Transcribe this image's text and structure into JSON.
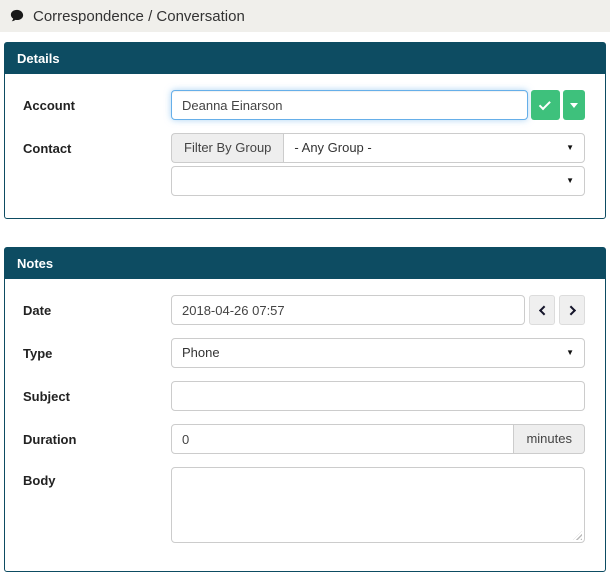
{
  "header": {
    "title": "Correspondence / Conversation"
  },
  "details": {
    "title": "Details",
    "account": {
      "label": "Account",
      "value": "Deanna Einarson"
    },
    "contact": {
      "label": "Contact",
      "filter_addon_label": "Filter By Group",
      "group_select_value": "- Any Group -",
      "contact_select_value": ""
    }
  },
  "notes": {
    "title": "Notes",
    "date": {
      "label": "Date",
      "value": "2018-04-26 07:57"
    },
    "type": {
      "label": "Type",
      "value": "Phone"
    },
    "subject": {
      "label": "Subject",
      "value": ""
    },
    "duration": {
      "label": "Duration",
      "value": "0",
      "unit_label": "minutes"
    },
    "body": {
      "label": "Body",
      "value": ""
    }
  },
  "colors": {
    "header_teal": "#0d4c62",
    "accent_green": "#3ec17c",
    "focus_blue": "#66afe9",
    "titlebar_bg": "#f0efeb"
  }
}
